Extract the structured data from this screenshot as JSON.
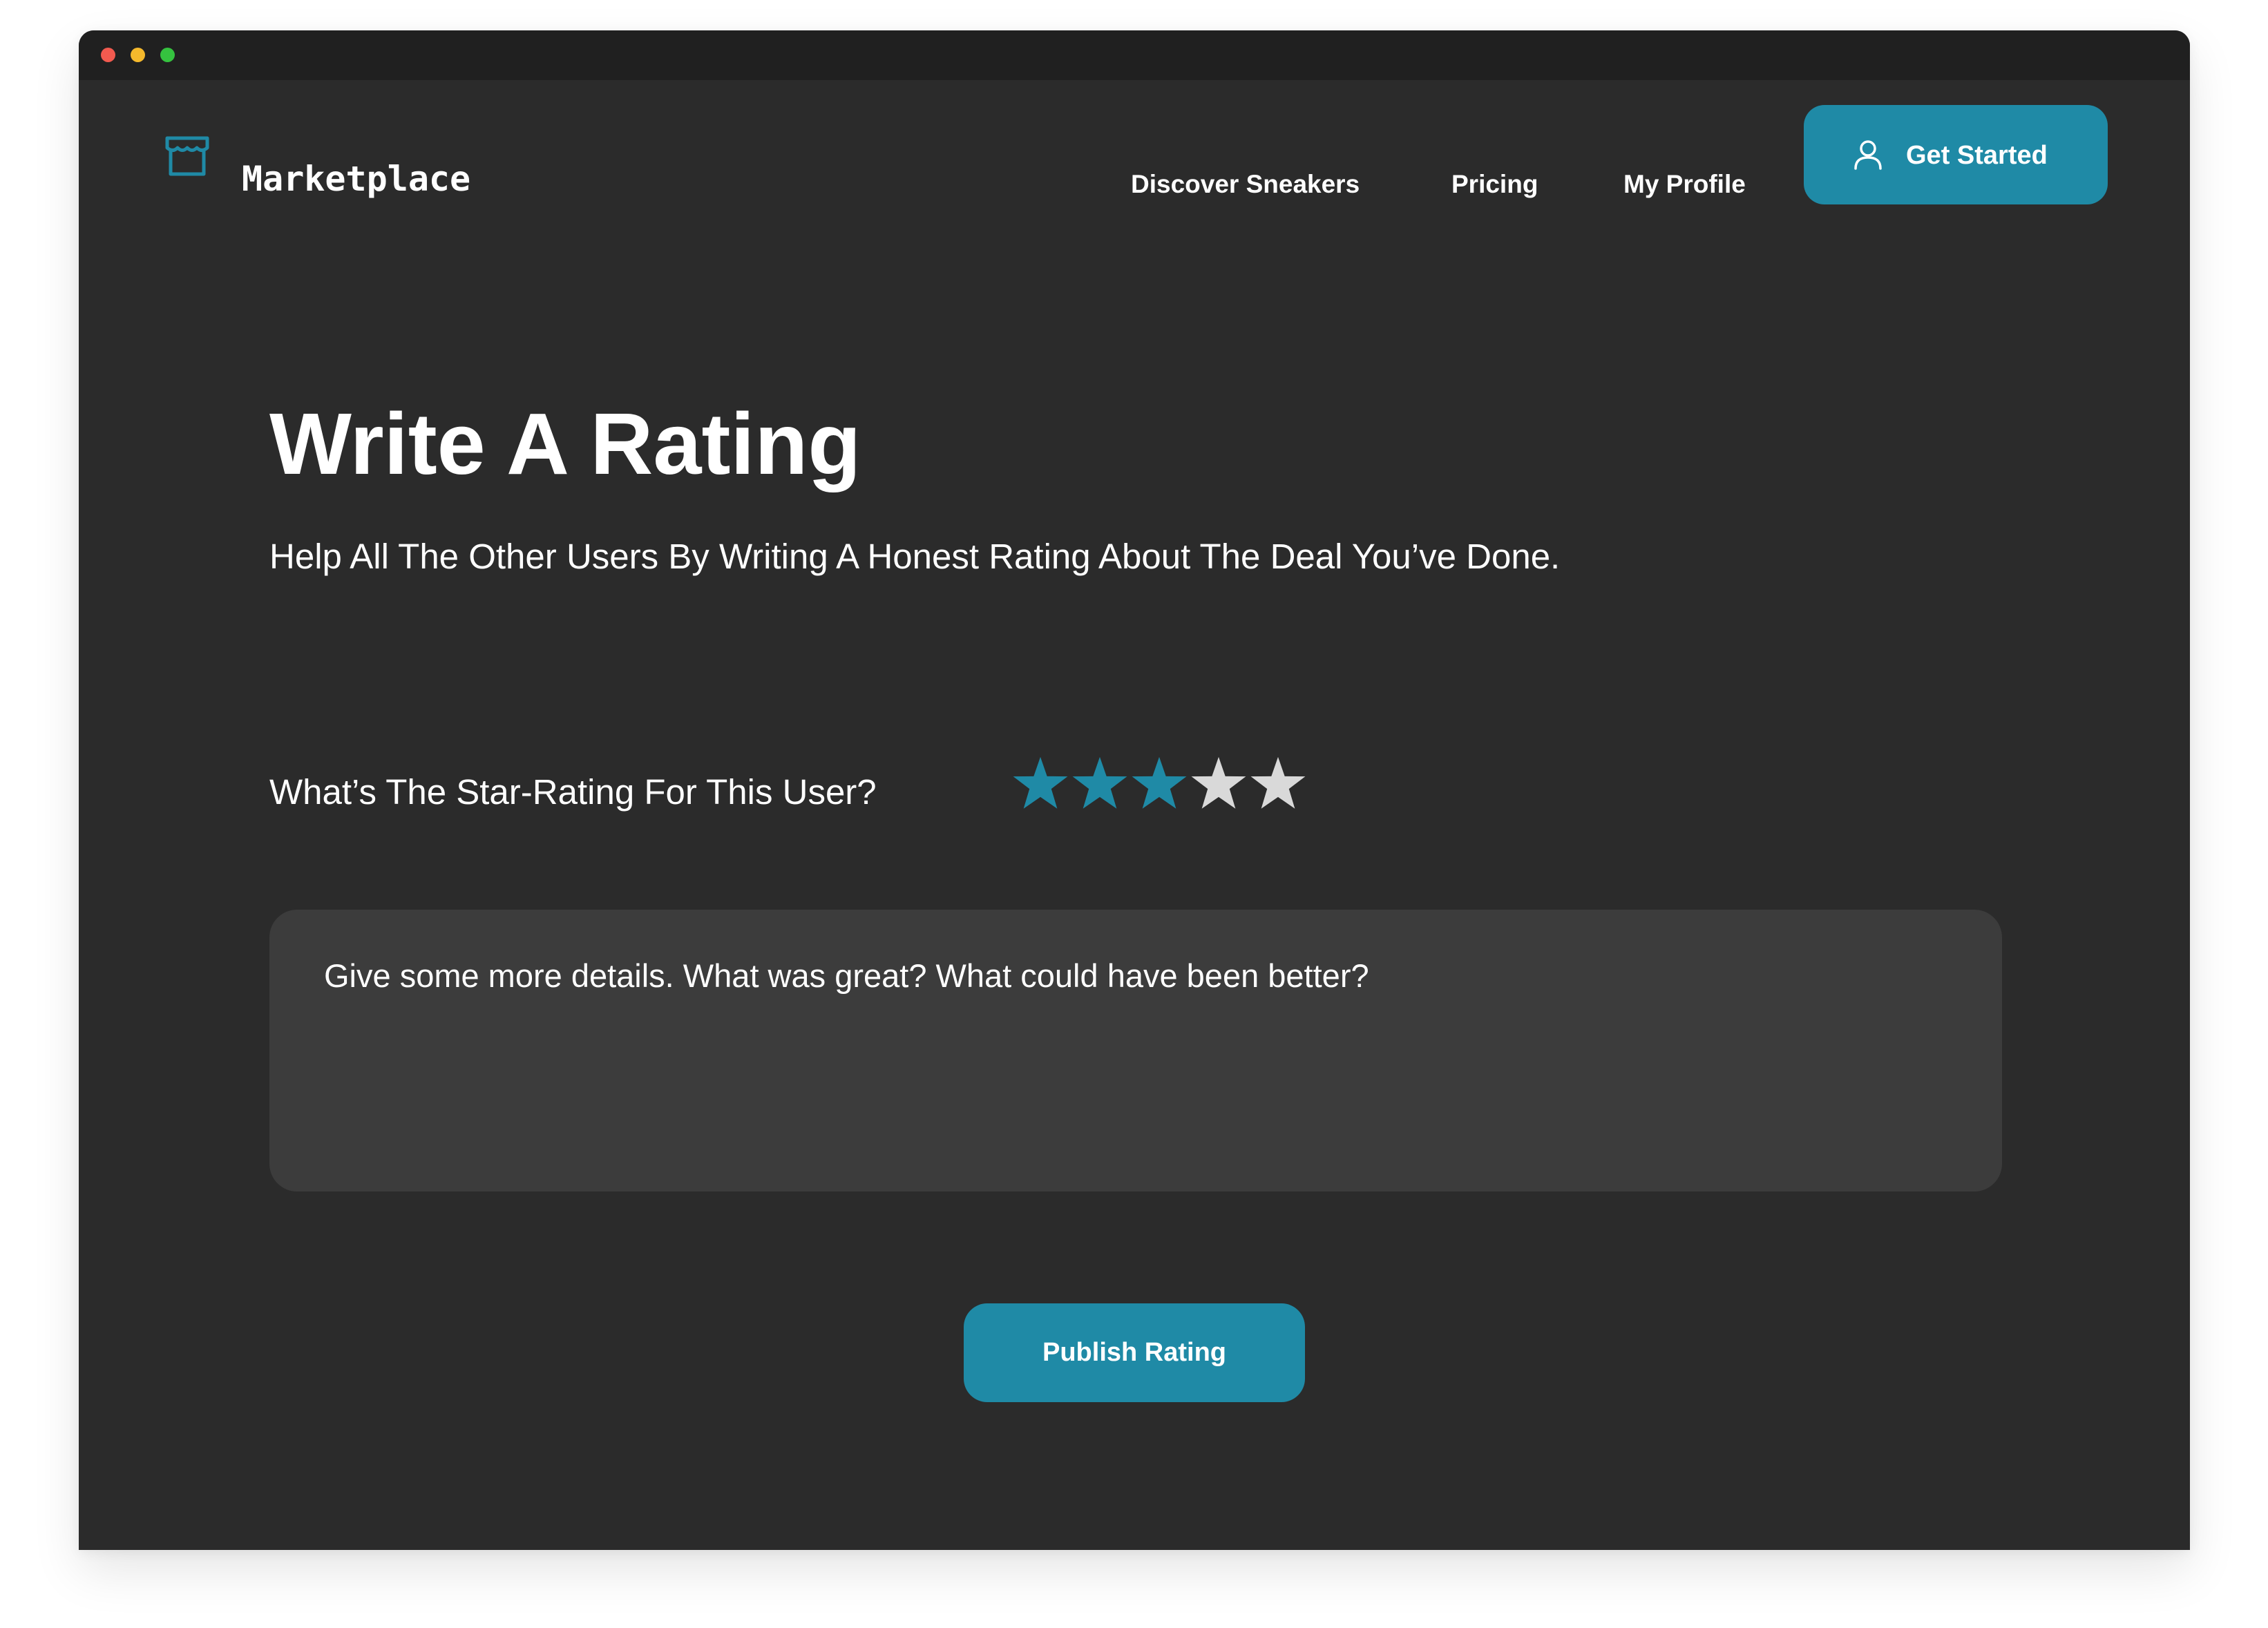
{
  "header": {
    "brand": "Marketplace",
    "brand_icon": "storefront-icon",
    "nav": [
      {
        "label": "Discover Sneakers"
      },
      {
        "label": "Pricing"
      },
      {
        "label": "My Profile"
      }
    ],
    "cta": {
      "label": "Get Started",
      "icon": "user-icon"
    }
  },
  "main": {
    "title": "Write A Rating",
    "subtitle": "Help All The Other Users By Writing A Honest Rating About The Deal You’ve Done.",
    "rating": {
      "question": "What’s The Star-Rating For This User?",
      "value": 3,
      "max": 5
    },
    "comment": {
      "placeholder": "Give some more details. What was great? What could have been better?"
    },
    "publish_label": "Publish Rating"
  },
  "colors": {
    "accent": "#1f8aa6",
    "background": "#2b2b2b",
    "titlebar": "#202020",
    "input_background": "#3c3c3c",
    "star_inactive": "#d9d9d9",
    "text": "#ffffff"
  }
}
